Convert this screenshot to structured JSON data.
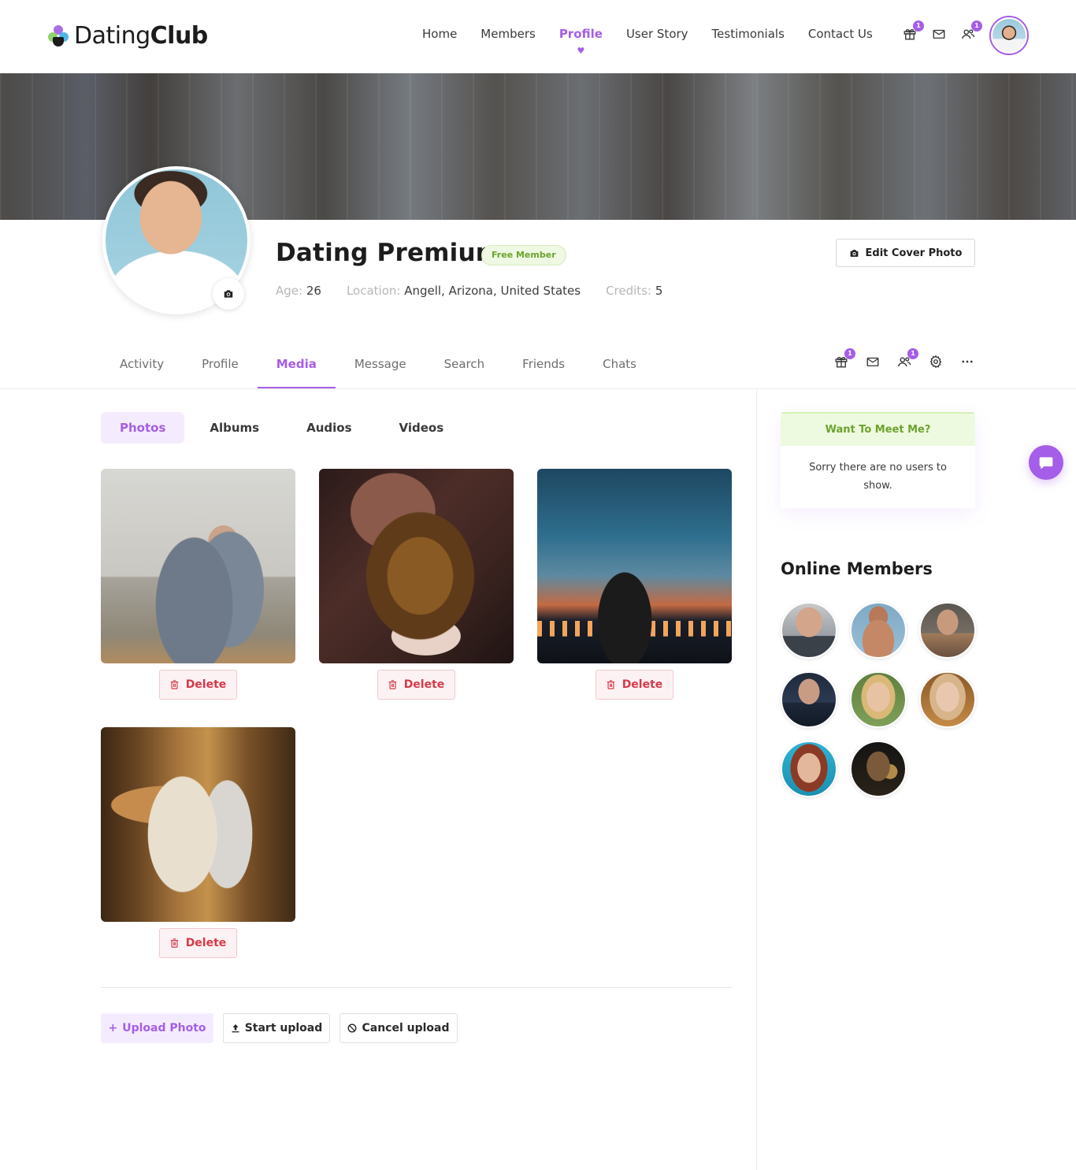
{
  "header": {
    "logo_light": "Dating",
    "logo_bold": "Club",
    "nav": [
      {
        "label": "Home"
      },
      {
        "label": "Members"
      },
      {
        "label": "Profile"
      },
      {
        "label": "User Story"
      },
      {
        "label": "Testimonials"
      },
      {
        "label": "Contact Us"
      }
    ],
    "badges": {
      "gift": "1",
      "friends": "1"
    }
  },
  "profile": {
    "name": "Dating Premium",
    "membership": "Free Member",
    "age_label": "Age:",
    "age": "26",
    "location_label": "Location:",
    "location": "Angell, Arizona, United States",
    "credits_label": "Credits:",
    "credits": "5",
    "edit_cover_label": "Edit Cover Photo"
  },
  "tabs": [
    {
      "label": "Activity"
    },
    {
      "label": "Profile"
    },
    {
      "label": "Media"
    },
    {
      "label": "Message"
    },
    {
      "label": "Search"
    },
    {
      "label": "Friends"
    },
    {
      "label": "Chats"
    }
  ],
  "tab_badges": {
    "gift": "1",
    "friends": "1"
  },
  "media": {
    "subtabs": [
      {
        "label": "Photos"
      },
      {
        "label": "Albums"
      },
      {
        "label": "Audios"
      },
      {
        "label": "Videos"
      }
    ],
    "delete_label": "Delete",
    "upload_photo": "Upload Photo",
    "start_upload": "Start upload",
    "cancel_upload": "Cancel upload"
  },
  "sidebar": {
    "meet_title": "Want To Meet Me?",
    "meet_body": "Sorry there are no users to show.",
    "online_title": "Online Members"
  },
  "colors": {
    "accent": "#a55ee7",
    "green": "#6ca32f",
    "danger": "#d43a4a"
  }
}
